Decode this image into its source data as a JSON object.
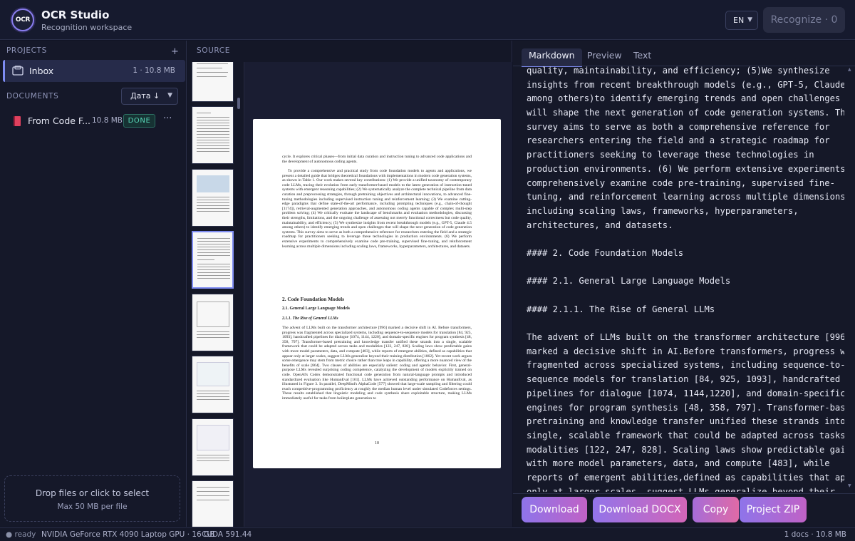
{
  "header": {
    "logo_text": "OCR",
    "title": "OCR Studio",
    "subtitle": "Recognition workspace",
    "language": "EN",
    "recognize_label": "Recognize · 0"
  },
  "sidebar": {
    "projects_label": "PROJECTS",
    "add_icon": "+",
    "project": {
      "name": "Inbox",
      "meta": "1 · 10.8 MB"
    },
    "documents_label": "DOCUMENTS",
    "sort_label": "Дата ↓",
    "document": {
      "name": "From Code F...",
      "size": "10.8 MB",
      "status": "DONE",
      "more": "···"
    },
    "dropzone": {
      "title": "Drop files or click to select",
      "hint": "Max 50 MB per file"
    }
  },
  "source": {
    "label": "SOURCE",
    "page": {
      "p1": "cycle. It explores critical phases—from initial data curation and instruction tuning to advanced code applications and the development of autonomous coding agents.",
      "p2": "To provide a comprehensive and practical study from code foundation models to agents and applications, we present a detailed guide that bridges theoretical foundations with implementations in modern code generation systems, as shown in Table 1. Our work makes several key contributions: (1) We provide a unified taxonomy of contemporary code LLMs, tracing their evolution from early transformer-based models to the latest generation of instruction-tuned systems with emergent reasoning capabilities; (2) We systematically analyze the complete technical pipeline from data curation and preprocessing strategies, through pretraining objectives and architectural innovations, to advanced fine-tuning methodologies including supervised instruction tuning and reinforcement learning; (3) We examine cutting-edge paradigms that define state-of-the-art performance, including prompting techniques (e.g., chain-of-thought [1174]), retrieval-augmented generation approaches, and autonomous coding agents capable of complex multi-step problem solving; (4) We critically evaluate the landscape of benchmarks and evaluation methodologies, discussing their strengths, limitations, and the ongoing challenge of assessing not merely functional correctness but code quality, maintainability, and efficiency; (5) We synthesize insights from recent breakthrough models (e.g., GPT-5, Claude 4.5 among others) to identify emerging trends and open challenges that will shape the next generation of code generation systems. This survey aims to serve as both a comprehensive reference for researchers entering the field and a strategic roadmap for practitioners seeking to leverage these technologies in production environments. (6) We perform extensive experiments to comprehensively examine code pre-training, supervised fine-tuning, and reinforcement learning across multiple dimensions including scaling laws, frameworks, hyperparameters, architectures, and datasets.",
      "h2": "2.  Code Foundation Models",
      "h3": "2.1.  General Large Language Models",
      "h4": "2.1.1.  The Rise of General LLMs",
      "p3": "The advent of LLMs built on the transformer architecture [996] marked a decisive shift in AI. Before transformers, progress was fragmented across specialized systems, including sequence-to-sequence models for translation [84, 925, 1093], handcrafted pipelines for dialogue [1074, 1144, 1220], and domain-specific engines for program synthesis [48, 358, 797]. Transformer-based pretraining and knowledge transfer unified these strands into a single, scalable framework that could be adapted across tasks and modalities [122, 247, 828]. Scaling laws show predictable gains with more model parameters, data, and compute [483], while reports of emergent abilities, defined as capabilities that appear only at larger scales, suggest LLMs generalize beyond their training distribution [1062]. Yet recent work argues some emergence may stem from metric choice rather than true leaps in capability, offering a more nuanced view of the benefits of scale [864]. Two classes of abilities are especially salient: coding and agentic behavior. First, general-purpose LLMs revealed surprising coding competence, catalyzing the development of models explicitly trained on code. OpenAI's Codex demonstrated functional code generation from natural-language prompts and introduced standardized evaluation like HumanEval [161]. LLMs have achieved outstanding performance on HumanEval, as illustrated in Figure 3. In parallel, DeepMind's AlphaCode [577] showed that large-scale sampling and filtering could reach competitive-programming proficiency at roughly the median human level under simulated Codeforces settings. These results established that linguistic modeling and code synthesis share exploitable structure, making LLMs immediately useful for tasks from boilerplate generation to",
      "page_number": "10"
    }
  },
  "output": {
    "tabs": [
      "Markdown",
      "Preview",
      "Text"
    ],
    "markdown_lines": [
      "quality, maintainability, and efficiency; (5)We synthesize",
      "insights from recent breakthrough models (e.g., GPT-5, Claude 4.5",
      "among others)to identify emerging trends and open challenges that",
      "will shape the next generation of code generation systems. This",
      "survey aims to serve as both a comprehensive reference for",
      "researchers entering the field and a strategic roadmap for",
      "practitioners seeking to leverage these technologies in",
      "production environments. (6) We perform extensive experiments to",
      "comprehensively examine code pre-training, supervised fine-",
      "tuning, and reinforcement learning across multiple dimensions",
      "including scaling laws, frameworks, hyperparameters,",
      "architectures, and datasets.",
      "",
      "#### 2. Code Foundation Models",
      "",
      "#### 2.1. General Large Language Models",
      "",
      "#### 2.1.1. The Rise of General LLMs",
      "",
      "The advent of LLMs built on the transformer architecture [996]",
      "marked a decisive shift in AI.Before transformers, progress was",
      "fragmented across specialized systems, including sequence-to-",
      "sequence models for translation [84, 925, 1093], handcrafted",
      "pipelines for dialogue [1074, 1144,1220], and domain-specific",
      "engines for program synthesis [48, 358, 797]. Transformer-based",
      "pretraining and knowledge transfer unified these strands into a",
      "single, scalable framework that could be adapted across tasks and",
      "modalities [122, 247, 828]. Scaling laws show predictable gains",
      "with more model parameters, data, and compute [483], while",
      "reports of emergent abilities,defined as capabilities that appear",
      "only at larger scales, suggest LLMs generalize beyond their"
    ],
    "actions": [
      "Download",
      "Download DOCX",
      "Copy",
      "Project ZIP"
    ]
  },
  "statusbar": {
    "state": "● ready",
    "gpu": "NVIDIA GeForce RTX 4090 Laptop GPU · 16 GB",
    "cuda": "CUDA 591.44",
    "summary": "1 docs · 10.8 MB"
  }
}
